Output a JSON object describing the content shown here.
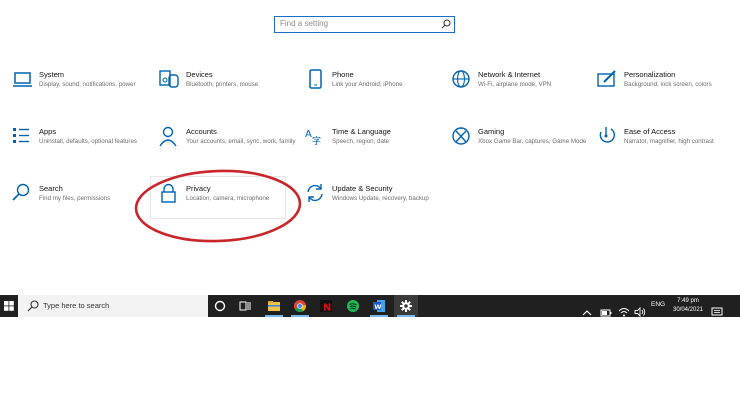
{
  "search": {
    "placeholder": "Find a setting"
  },
  "categories": [
    {
      "title": "System",
      "desc": "Display, sound, notifications, power",
      "icon": "laptop-icon"
    },
    {
      "title": "Devices",
      "desc": "Bluetooth, printers, mouse",
      "icon": "devices-icon"
    },
    {
      "title": "Phone",
      "desc": "Link your Android, iPhone",
      "icon": "phone-icon"
    },
    {
      "title": "Network & Internet",
      "desc": "Wi-Fi, airplane mode, VPN",
      "icon": "globe-icon"
    },
    {
      "title": "Personalization",
      "desc": "Background, lock screen, colors",
      "icon": "paint-icon"
    },
    {
      "title": "Apps",
      "desc": "Uninstall, defaults, optional features",
      "icon": "apps-list-icon"
    },
    {
      "title": "Accounts",
      "desc": "Your accounts, email, sync, work, family",
      "icon": "person-icon"
    },
    {
      "title": "Time & Language",
      "desc": "Speech, region, date",
      "icon": "time-language-icon"
    },
    {
      "title": "Gaming",
      "desc": "Xbox Game Bar, captures, Game Mode",
      "icon": "xbox-icon"
    },
    {
      "title": "Ease of Access",
      "desc": "Narrator, magnifier, high contrast",
      "icon": "ease-of-access-icon"
    },
    {
      "title": "Search",
      "desc": "Find my files, permissions",
      "icon": "search-icon"
    },
    {
      "title": "Privacy",
      "desc": "Location, camera, microphone",
      "icon": "lock-icon"
    },
    {
      "title": "Update & Security",
      "desc": "Windows Update, recovery, backup",
      "icon": "sync-icon"
    }
  ],
  "taskbar": {
    "search_text": "Type here to search",
    "apps": [
      "cortana-icon",
      "task-view-icon",
      "file-explorer-icon",
      "chrome-icon",
      "netflix-icon",
      "spotify-icon",
      "word-icon",
      "settings-icon"
    ],
    "language": "ENG",
    "time": "7:49 pm",
    "date": "30/04/2021"
  },
  "colors": {
    "accent": "#0063b1",
    "annotation": "#c8262b",
    "taskbar": "#202020"
  }
}
